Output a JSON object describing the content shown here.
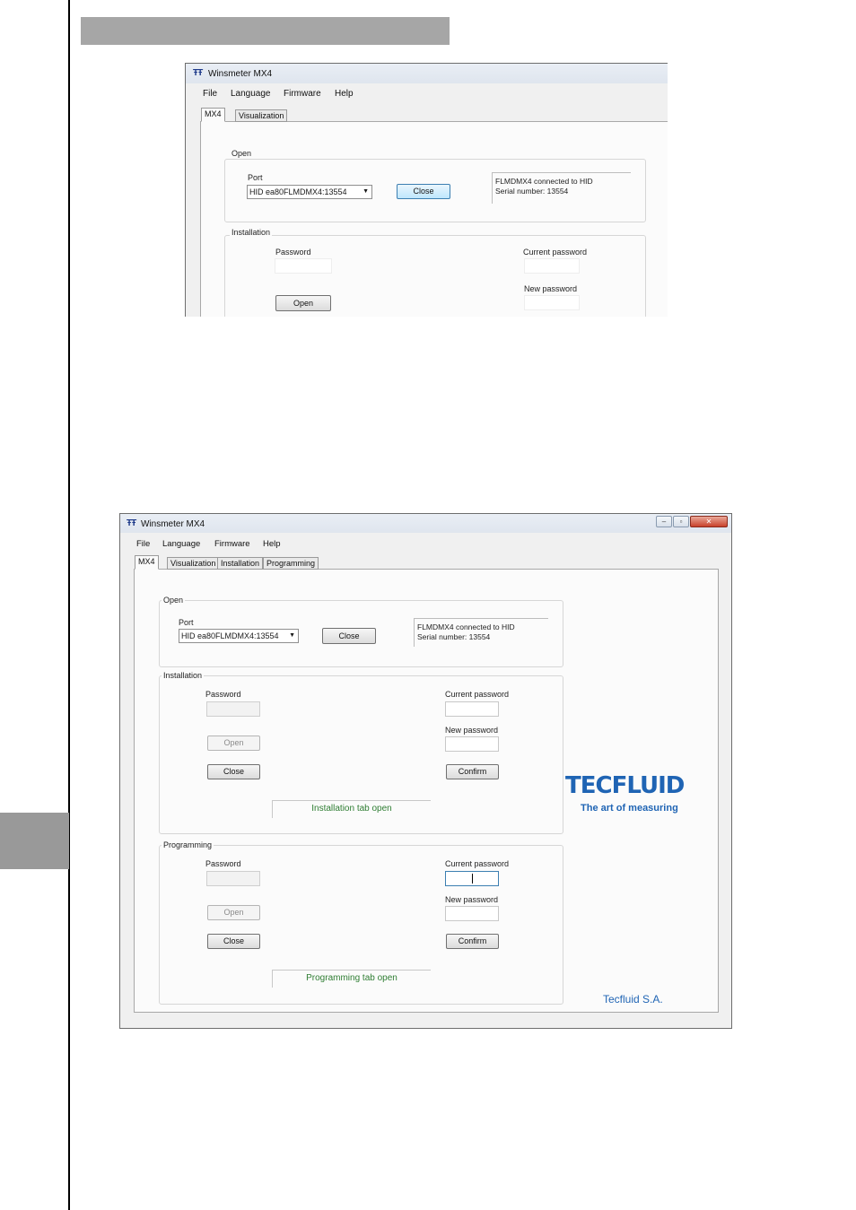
{
  "window_small": {
    "title": "Winsmeter MX4",
    "menu": [
      "File",
      "Language",
      "Firmware",
      "Help"
    ],
    "tabs": [
      "MX4",
      "Visualization"
    ],
    "open_group": {
      "title": "Open",
      "port_label": "Port",
      "port_value": "HID ea80FLMDMX4:13554",
      "close_button": "Close",
      "info_line1": "FLMDMX4 connected to HID",
      "info_line2": "Serial number: 13554"
    },
    "installation_group": {
      "title": "Installation",
      "password_label": "Password",
      "open_button": "Open",
      "current_password_label": "Current password",
      "new_password_label": "New password"
    }
  },
  "window_large": {
    "title": "Winsmeter MX4",
    "menu": [
      "File",
      "Language",
      "Firmware",
      "Help"
    ],
    "tabs": [
      "MX4",
      "Visualization",
      "Installation",
      "Programming"
    ],
    "open_group": {
      "title": "Open",
      "port_label": "Port",
      "port_value": "HID ea80FLMDMX4:13554",
      "close_button": "Close",
      "info_line1": "FLMDMX4 connected to HID",
      "info_line2": "Serial number: 13554"
    },
    "installation_group": {
      "title": "Installation",
      "password_label": "Password",
      "open_button": "Open",
      "close_button": "Close",
      "current_password_label": "Current password",
      "new_password_label": "New password",
      "confirm_button": "Confirm",
      "status": "Installation tab open"
    },
    "programming_group": {
      "title": "Programming",
      "password_label": "Password",
      "open_button": "Open",
      "close_button": "Close",
      "current_password_label": "Current password",
      "new_password_label": "New password",
      "confirm_button": "Confirm",
      "status": "Programming tab open"
    },
    "brand": {
      "logo_text": "TECFLUID",
      "tagline": "The art of measuring",
      "company": "Tecfluid S.A."
    },
    "window_buttons": [
      "minimize-icon",
      "maximize-icon",
      "close-icon"
    ]
  },
  "colors": {
    "brand_blue": "#1f64b4",
    "status_green": "#2e7d32",
    "side_gray": "#999999"
  }
}
